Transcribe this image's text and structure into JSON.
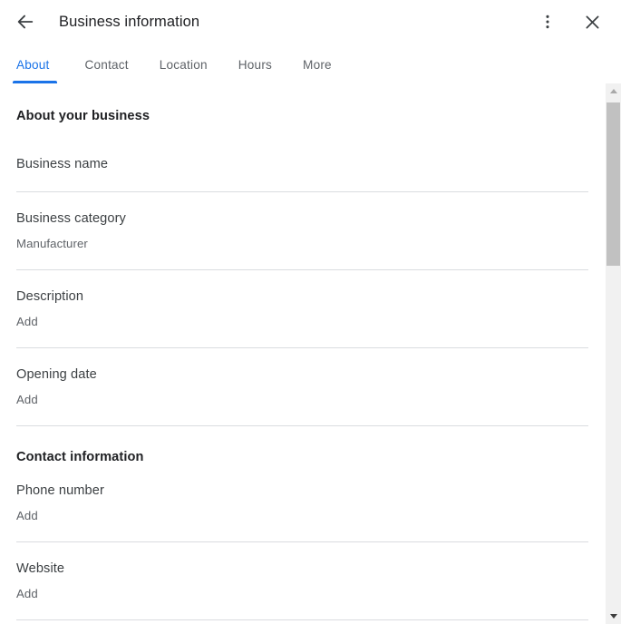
{
  "header": {
    "title": "Business information",
    "back_icon": "arrow-left-icon",
    "more_icon": "more-vertical-icon",
    "close_icon": "close-icon"
  },
  "tabs": [
    {
      "label": "About",
      "active": true
    },
    {
      "label": "Contact",
      "active": false
    },
    {
      "label": "Location",
      "active": false
    },
    {
      "label": "Hours",
      "active": false
    },
    {
      "label": "More",
      "active": false
    }
  ],
  "sections": [
    {
      "title": "About your business",
      "rows": [
        {
          "label": "Business name",
          "value": ""
        },
        {
          "label": "Business category",
          "value": "Manufacturer"
        },
        {
          "label": "Description",
          "value": "Add"
        },
        {
          "label": "Opening date",
          "value": "Add"
        }
      ]
    },
    {
      "title": "Contact information",
      "rows": [
        {
          "label": "Phone number",
          "value": "Add"
        },
        {
          "label": "Website",
          "value": "Add"
        }
      ]
    }
  ],
  "scrollbar": {
    "up_arrow_icon": "triangle-up-icon",
    "down_arrow_icon": "triangle-down-icon",
    "thumb": "scrollbar-thumb"
  },
  "colors": {
    "accent": "#1a73e8",
    "text_primary": "#202124",
    "text_secondary": "#5f6368",
    "divider": "#dadce0",
    "background": "#ffffff"
  }
}
